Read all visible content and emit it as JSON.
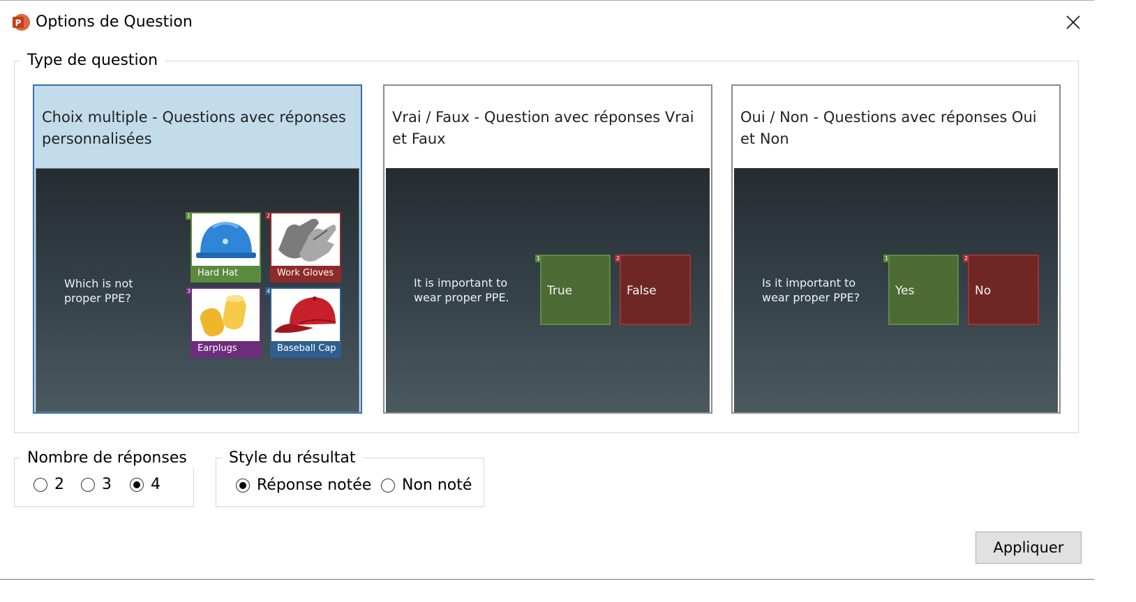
{
  "window": {
    "title": "Options de Question",
    "app_icon": "powerpoint-icon",
    "app_icon_letter": "P",
    "close_icon": "close-icon"
  },
  "question_type": {
    "legend": "Type de question",
    "options": [
      {
        "title": "Choix multiple - Questions avec réponses personnalisées",
        "selected": true,
        "preview": {
          "question": "Which is not proper PPE?",
          "tiles": [
            {
              "num": "1",
              "label": "Hard Hat",
              "color": "#5a8a3c",
              "icon": "hard-hat-icon"
            },
            {
              "num": "2",
              "label": "Work Gloves",
              "color": "#8e2a2a",
              "icon": "work-gloves-icon"
            },
            {
              "num": "3",
              "label": "Earplugs",
              "color": "#6d2d7a",
              "icon": "earplugs-icon"
            },
            {
              "num": "4",
              "label": "Baseball Cap",
              "color": "#2e5f8f",
              "icon": "baseball-cap-icon"
            }
          ]
        }
      },
      {
        "title": "Vrai / Faux - Question avec réponses Vrai et Faux",
        "selected": false,
        "preview": {
          "question": "It is important to wear proper PPE.",
          "tiles": [
            {
              "num": "1",
              "label": "True",
              "color": "#4c6b35"
            },
            {
              "num": "2",
              "label": "False",
              "color": "#6e2725"
            }
          ]
        }
      },
      {
        "title": "Oui / Non - Questions avec réponses Oui et Non",
        "selected": false,
        "preview": {
          "question": "Is it important to wear proper PPE?",
          "tiles": [
            {
              "num": "1",
              "label": "Yes",
              "color": "#4c6b35"
            },
            {
              "num": "2",
              "label": "No",
              "color": "#6e2725"
            }
          ]
        }
      }
    ]
  },
  "answer_count": {
    "legend": "Nombre de réponses",
    "options": [
      "2",
      "3",
      "4"
    ],
    "selected": "4"
  },
  "result_style": {
    "legend": "Style du résultat",
    "options": [
      "Réponse notée",
      "Non noté"
    ],
    "selected": "Réponse notée"
  },
  "apply_button": "Appliquer",
  "colors": {
    "selected_card_bg": "#c3dcec",
    "selected_card_border": "#356ea8",
    "powerpoint_orange": "#c43e1c"
  }
}
